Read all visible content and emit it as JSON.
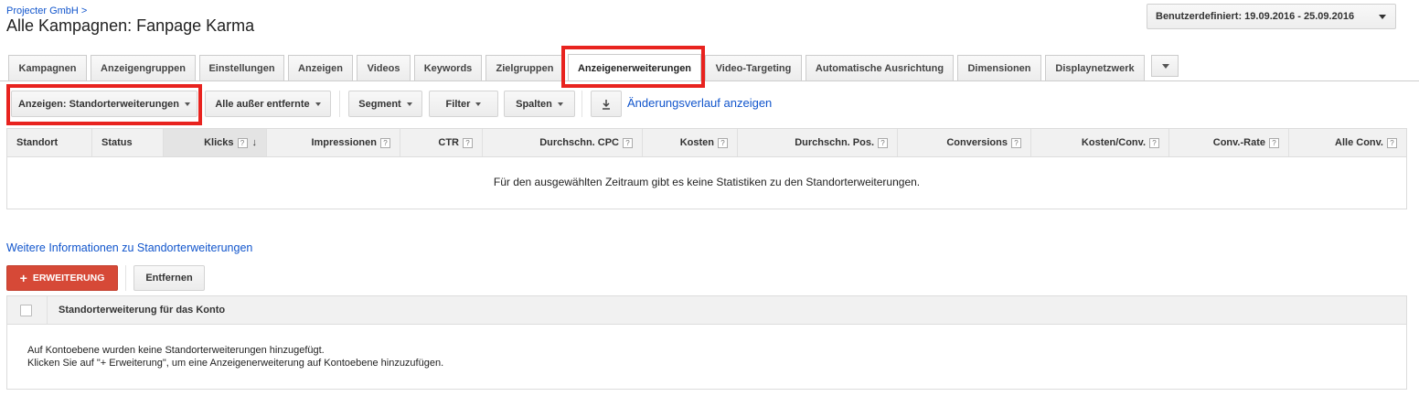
{
  "header": {
    "breadcrumb": "Projecter GmbH >",
    "title": "Alle Kampagnen: Fanpage Karma",
    "date_range": "Benutzerdefiniert: 19.09.2016 - 25.09.2016"
  },
  "tabs": [
    {
      "label": "Kampagnen"
    },
    {
      "label": "Anzeigengruppen"
    },
    {
      "label": "Einstellungen"
    },
    {
      "label": "Anzeigen"
    },
    {
      "label": "Videos"
    },
    {
      "label": "Keywords"
    },
    {
      "label": "Zielgruppen"
    },
    {
      "label": "Anzeigenerweiterungen"
    },
    {
      "label": "Video-Targeting"
    },
    {
      "label": "Automatische Ausrichtung"
    },
    {
      "label": "Dimensionen"
    },
    {
      "label": "Displaynetzwerk"
    }
  ],
  "active_tab": "Anzeigenerweiterungen",
  "toolbar": {
    "view_select": "Anzeigen: Standorterweiterungen",
    "status_filter": "Alle außer entfernte",
    "segment": "Segment",
    "filter": "Filter",
    "columns": "Spalten",
    "history_link": "Änderungsverlauf anzeigen"
  },
  "stats_table": {
    "columns": [
      {
        "label": "Standort",
        "help": ""
      },
      {
        "label": "Status",
        "help": ""
      },
      {
        "label": "Klicks",
        "help": "?"
      },
      {
        "label": "Impressionen",
        "help": "?"
      },
      {
        "label": "CTR",
        "help": "?"
      },
      {
        "label": "Durchschn. CPC",
        "help": "?"
      },
      {
        "label": "Kosten",
        "help": "?"
      },
      {
        "label": "Durchschn. Pos.",
        "help": "?"
      },
      {
        "label": "Conversions",
        "help": "?"
      },
      {
        "label": "Kosten/Conv.",
        "help": "?"
      },
      {
        "label": "Conv.-Rate",
        "help": "?"
      },
      {
        "label": "Alle Conv.",
        "help": "?"
      }
    ],
    "sort_indicator": "↓",
    "empty_message": "Für den ausgewählten Zeitraum gibt es keine Statistiken zu den Standorterweiterungen."
  },
  "more_info_link": "Weitere Informationen zu Standorterweiterungen",
  "actions": {
    "add_icon": "+",
    "add_label": "ERWEITERUNG",
    "remove_label": "Entfernen"
  },
  "account_table": {
    "header": "Standorterweiterung für das Konto",
    "line1": "Auf Kontoebene wurden keine Standorterweiterungen hinzugefügt.",
    "line2": "Klicken Sie auf \"+ Erweiterung\", um eine Anzeigenerweiterung auf Kontoebene hinzuzufügen."
  },
  "colors": {
    "highlight": "#e8231f",
    "link": "#1155cc",
    "add_button": "#d64937"
  }
}
